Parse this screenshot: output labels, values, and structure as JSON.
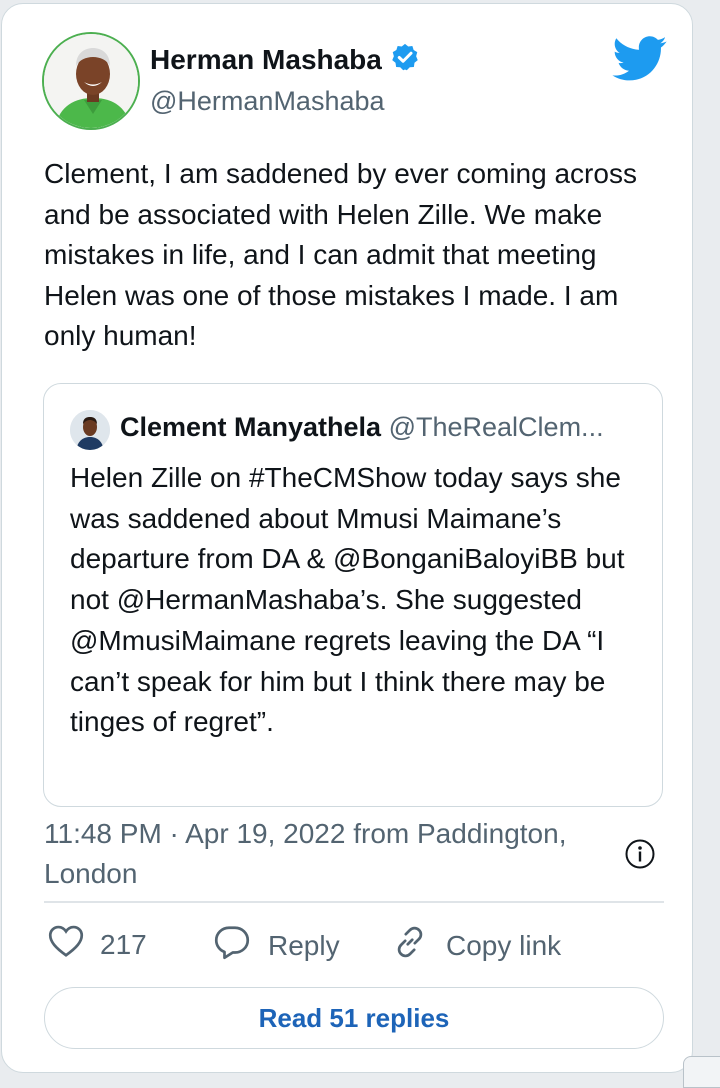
{
  "tweet": {
    "author": {
      "name": "Herman Mashaba",
      "handle": "@HermanMashaba",
      "verified": true
    },
    "text": "Clement, I am saddened by ever coming across and be associated with Helen Zille. We make mistakes in life, and I can admit that meeting Helen was one of those mistakes I made. I am only human!",
    "quoted": {
      "name": "Clement Manyathela",
      "handle": "@TheRealClem...",
      "text": "Helen Zille on #TheCMShow today says she was saddened about Mmusi Maimane’s departure from DA & @BonganiBaloyiBB but not @HermanMashaba’s. She suggested @MmusiMaimane regrets leaving the DA “I can’t speak for him but I think there may be tinges of regret”."
    },
    "timestamp": "11:48 PM · Apr 19, 2022 from Paddington, London"
  },
  "actions": {
    "like_count": "217",
    "reply_label": "Reply",
    "copy_label": "Copy link"
  },
  "read_replies_label": "Read 51 replies",
  "colors": {
    "brand_blue": "#1d9bf0",
    "link_blue": "#1d64b8",
    "muted_text": "#536471",
    "border": "#cfd9de"
  },
  "icons": [
    "twitter-bird-icon",
    "verified-badge-icon",
    "info-icon",
    "heart-icon",
    "reply-icon",
    "link-icon"
  ]
}
